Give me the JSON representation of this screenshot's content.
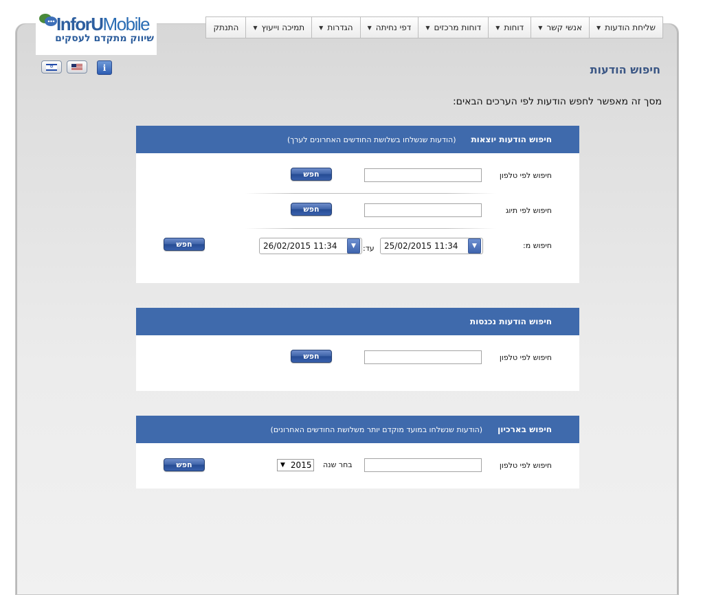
{
  "logo": {
    "brand_part1": "InforU",
    "brand_part2": "Mobile",
    "tagline": "שיווק מתקדם לעסקים"
  },
  "nav": [
    {
      "label": "שליחת הודעות"
    },
    {
      "label": "אנשי קשר"
    },
    {
      "label": "דוחות"
    },
    {
      "label": "דוחות מרכזים"
    },
    {
      "label": "דפי נחיתה"
    },
    {
      "label": "הגדרות"
    },
    {
      "label": "תמיכה וייעוץ"
    },
    {
      "label": "התנתק"
    }
  ],
  "icons": {
    "hebrew_flag": "israel-flag-icon",
    "english_flag": "us-flag-icon",
    "info": "i"
  },
  "page": {
    "title": "חיפוש הודעות",
    "intro": "מסך זה מאפשר לחפש הודעות לפי הערכים הבאים:"
  },
  "outgoing": {
    "title": "חיפוש הודעות יוצאות",
    "note": "(הודעות שנשלחו בשלושת החודשים האחרונים לערך)",
    "phone_label": "חיפוש לפי טלפון",
    "tag_label": "חיפוש לפי תיוג",
    "date_label": "חיפוש מ:",
    "to_label": "עד:",
    "date_from": "25/02/2015 11:34",
    "date_to": "26/02/2015 11:34",
    "phone_value": "",
    "tag_value": "",
    "button": "חפש"
  },
  "incoming": {
    "title": "חיפוש הודעות נכנסות",
    "phone_label": "חיפוש לפי טלפון",
    "phone_value": "",
    "button": "חפש"
  },
  "archive": {
    "title": "חיפוש בארכיון",
    "note": "(הודעות שנשלחו במועד מוקדם יותר משלושת החודשים האחרונים)",
    "phone_label": "חיפוש לפי טלפון",
    "phone_value": "",
    "year_label": "בחר שנה",
    "year_value": "2015",
    "button": "חפש"
  },
  "colors": {
    "header_blue": "#3f6aac",
    "title_blue": "#3a5684",
    "button_blue": "#3e63a9"
  }
}
